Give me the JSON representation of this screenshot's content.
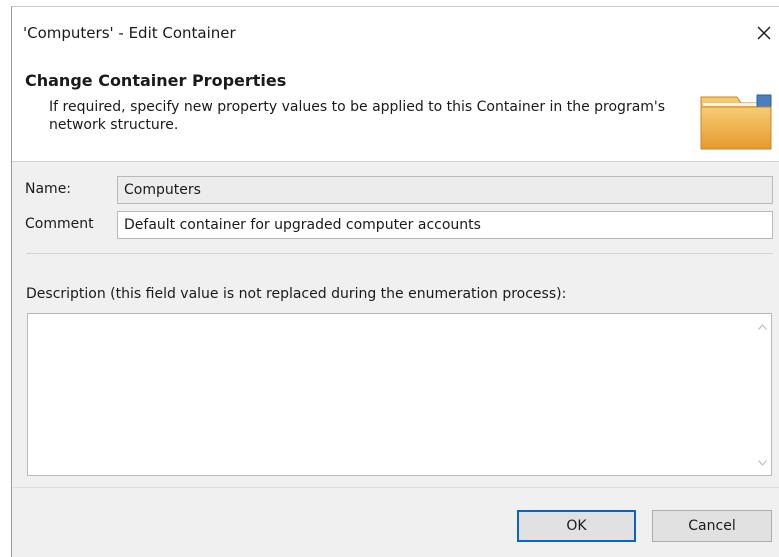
{
  "window": {
    "title": "'Computers' - Edit Container"
  },
  "header": {
    "title": "Change Container Properties",
    "description": "If required, specify new property values to be applied to this Container in the program's network structure.",
    "icon": "folder-icon"
  },
  "form": {
    "name_label": "Name:",
    "name_value": "Computers",
    "comment_label": "Comment",
    "comment_value": "Default container for upgraded computer accounts",
    "description_label": "Description (this field value is not replaced during the enumeration process):",
    "description_value": ""
  },
  "buttons": {
    "ok_label": "OK",
    "cancel_label": "Cancel"
  },
  "colors": {
    "default_button_border": "#0a64c8",
    "folder_body": "#f0b454",
    "folder_tab": "#4a7ec0"
  }
}
